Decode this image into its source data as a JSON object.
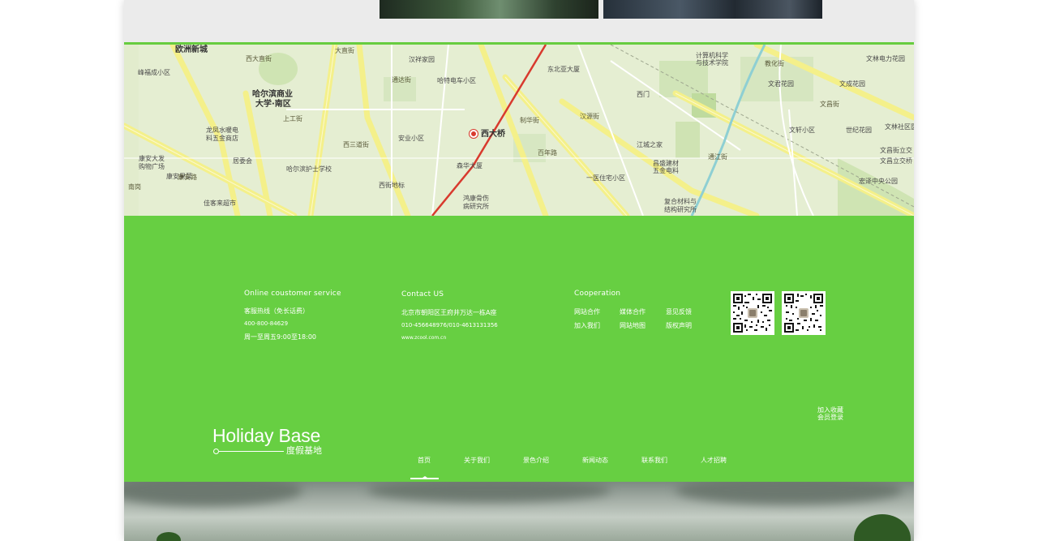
{
  "map": {
    "labels": {
      "ouzhou": "欧洲新城",
      "fengxing": "峰福成小区",
      "shangye": "哈尔滨商业",
      "nanqu": "大学·南区",
      "longfeng": "龙凤水暖电",
      "wujin": "料五金商店",
      "juweihui": "居委会",
      "kangan": "康安大发",
      "gouwu": "购物广场",
      "hanxiang": "汉祥家园",
      "hajiang_che": "哈特电车小区",
      "hahushi": "哈尔滨护士学校",
      "anye": "安业小区",
      "xijie": "西街地标",
      "senhua": "森华大厦",
      "honghua": "鸿康骨伤",
      "bingyan": "病研究所",
      "xidaqiao": "西大桥",
      "dongbeiya": "东北亚大厦",
      "ximen": "西门",
      "jiangcheng": "江城之家",
      "changsheng": "昌盛建材",
      "wujin_dian": "五金电料",
      "fuhe": "复合材料与",
      "jiegou": "结构研究所",
      "yimin": "一医住宅小区",
      "jisuan": "计算机科学",
      "jishu": "与技术学院",
      "wenlin": "文林电力花园",
      "wenjun": "文君花园",
      "wencheng": "文成花园",
      "wenxuan": "文轩小区",
      "shiji": "世纪花园",
      "wenchang_li": "文昌街立交",
      "wenchang_qiao": "文昌立交桥",
      "hongze": "宏泽中央公园",
      "jiaxin": "佳客来超市",
      "wenlin_li": "文林社区医",
      "shancai": "康安果菜",
      "dazhi": "大直街",
      "xidazhi": "西大直街",
      "hanyuan": "汉源街",
      "jiaohua": "教化街",
      "tongda": "通达街",
      "wenchang": "文昌街",
      "zhihua": "制华街",
      "tongjiang": "通江街",
      "xisanjie": "西三道街",
      "kangan_lu": "康安路",
      "shanggong": "上工街",
      "nangang": "南岗",
      "bainian": "百年路"
    }
  },
  "footer": {
    "service": {
      "title": "Online coustomer service",
      "hotline": "客服热线（免长话费）",
      "phone": "400-800-84629",
      "hours": "周一至周五9:00至18:00"
    },
    "contact": {
      "title": "Contact US",
      "address": "北京市朝阳区王府井万达一栋A座",
      "phones": "010-456648976/010-4613131356",
      "web": "www.zcool.com.cn"
    },
    "cooperation": {
      "title": "Cooperation",
      "links": [
        "网站合作",
        "媒体合作",
        "意见反馈",
        "加入我们",
        "网站地图",
        "版权声明"
      ]
    },
    "logo": {
      "main": "Holiday Base",
      "sub": "度假基地"
    },
    "side": {
      "bookmark": "加入收藏",
      "login": "会员登录"
    },
    "nav": [
      "首页",
      "关于我们",
      "景色介绍",
      "新闻动态",
      "联系我们",
      "人才招聘"
    ]
  },
  "colors": {
    "brand_green": "#67cf42",
    "map_bg": "#e2eccd",
    "road_yellow": "#f4f08a",
    "metro_red": "#d83a2e"
  }
}
